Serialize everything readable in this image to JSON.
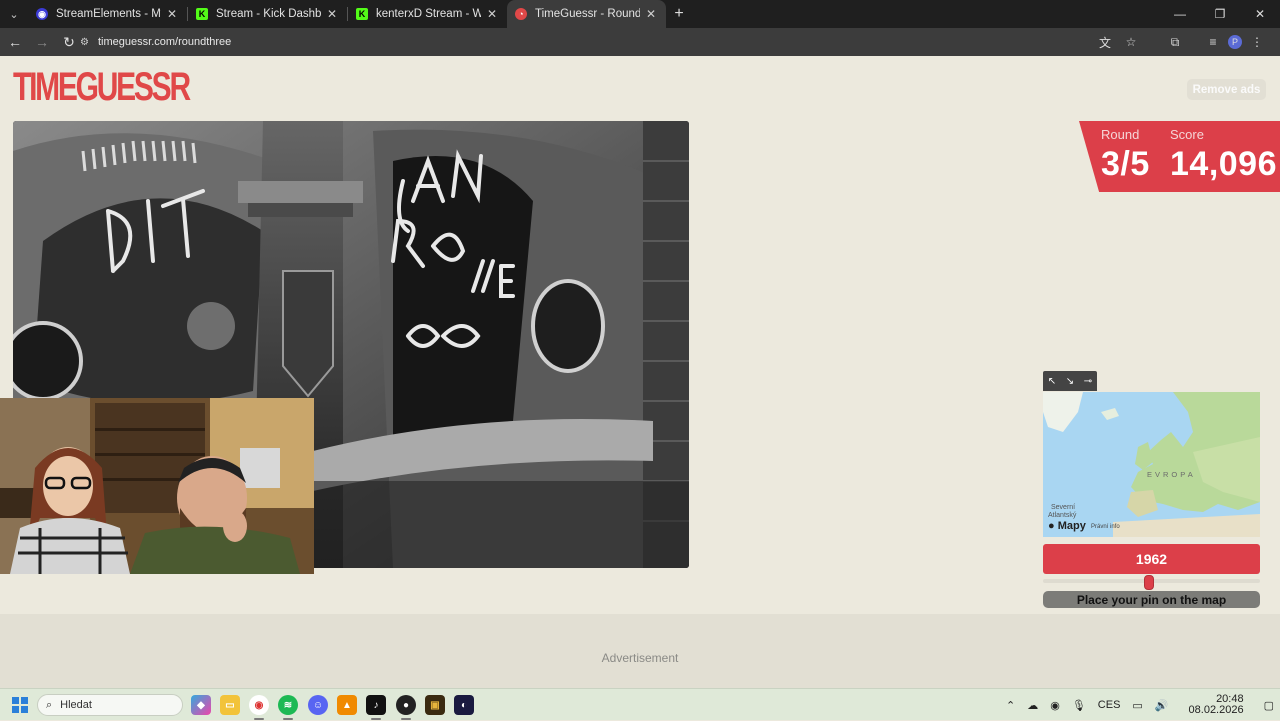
{
  "browser": {
    "tabs": [
      {
        "title": "StreamElements - My dashboard",
        "favicon_color": "#3b3bd6",
        "favicon": "◉",
        "active": false
      },
      {
        "title": "Stream - Kick Dashboard",
        "favicon_color": "#53fc18",
        "favicon": "K",
        "active": false
      },
      {
        "title": "kenterxD Stream - Watch Live o",
        "favicon_color": "#53fc18",
        "favicon": "K",
        "active": false
      },
      {
        "title": "TimeGuessr - Round Three",
        "favicon_color": "#e04848",
        "favicon": "◔",
        "active": true
      }
    ],
    "url": "timeguessr.com/roundthree",
    "profile_initial": "P"
  },
  "page": {
    "logo": "TIMEGUESSR",
    "remove_ads": "Remove ads",
    "round_label": "Round",
    "round_value": "3/5",
    "score_label": "Score",
    "score_value": "14,096",
    "map": {
      "controls": [
        "expand-icon",
        "shrink-icon",
        "pin-icon"
      ],
      "ocean_label_1": "Severní",
      "ocean_label_2": "Atlantský",
      "region_label": "EVROPA",
      "brand": "Mapy",
      "legal": "Právní info"
    },
    "year": "1962",
    "year_slider_fraction": 0.49,
    "place_pin": "Place your pin on the map",
    "advertisement": "Advertisement"
  },
  "taskbar": {
    "search_placeholder": "Hledat",
    "language": "CES",
    "time": "20:48",
    "date": "08.02.2026"
  },
  "colors": {
    "accent": "#dc3f49",
    "page_bg": "#ece9dd"
  }
}
